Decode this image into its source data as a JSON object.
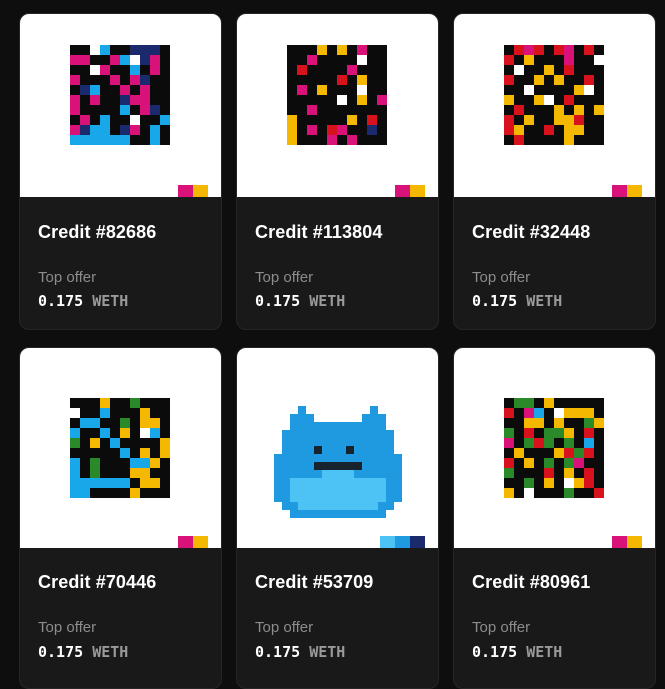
{
  "cards": [
    {
      "title": "Credit #82686",
      "offer_label": "Top offer",
      "price": "0.175",
      "currency": "WETH",
      "art": {
        "cols": 10,
        "rows": 10,
        "palette": [
          "#0b0b0b",
          "#d9127a",
          "#18a7e8",
          "#ffffff",
          "#1a2a6c"
        ],
        "pixels": [
          "0032004440",
          "1100123410",
          "0031002010",
          "1000101400",
          "0420010100",
          "1010041100",
          "1000020140",
          "0102003002",
          "1422041020",
          "2222220020"
        ]
      },
      "swatch": [
        "#d9127a",
        "#f5b800"
      ]
    },
    {
      "title": "Credit #113804",
      "offer_label": "Top offer",
      "price": "0.175",
      "currency": "WETH",
      "art": {
        "cols": 10,
        "rows": 10,
        "palette": [
          "#0b0b0b",
          "#d9127a",
          "#f5b800",
          "#18a7e8",
          "#ffffff",
          "#d8121c",
          "#1a2a6c"
        ],
        "pixels": [
          "0002020100",
          "0010000400",
          "0500001000",
          "0000050200",
          "0102000400",
          "0000040201",
          "0010000000",
          "2000002050",
          "2010510060",
          "2000101000"
        ]
      },
      "swatch": [
        "#d9127a",
        "#f5b800"
      ]
    },
    {
      "title": "Credit #32448",
      "offer_label": "Top offer",
      "price": "0.175",
      "currency": "WETH",
      "art": {
        "cols": 10,
        "rows": 10,
        "palette": [
          "#0b0b0b",
          "#d8121c",
          "#f5b800",
          "#ffffff",
          "#d9127a"
        ],
        "pixels": [
          "0141014010",
          "1020004003",
          "0300201000",
          "1002020010",
          "0030000230",
          "2002301000",
          "0100020202",
          "1020022100",
          "1200102200",
          "0100002000"
        ]
      },
      "swatch": [
        "#d9127a",
        "#f5b800"
      ]
    },
    {
      "title": "Credit #70446",
      "offer_label": "Top offer",
      "price": "0.175",
      "currency": "WETH",
      "art": {
        "cols": 10,
        "rows": 10,
        "palette": [
          "#0b0b0b",
          "#f5b800",
          "#18a7e8",
          "#2a8a2a",
          "#ffffff"
        ],
        "pixels": [
          "0001003000",
          "4002000100",
          "0220030110",
          "2002010420",
          "3010200001",
          "0000020101",
          "2030002210",
          "2030001100",
          "2222220110",
          "2200001000"
        ]
      },
      "swatch": [
        "#d9127a",
        "#f5b800"
      ]
    },
    {
      "title": "Credit #53709",
      "offer_label": "Top offer",
      "price": "0.175",
      "currency": "WETH",
      "art": {
        "cols": 16,
        "rows": 15,
        "palette": [
          "transparent",
          "#1f9ae0",
          "#17232f",
          "#4cc3f4"
        ],
        "pixels": [
          "0000000000000000",
          "0001000000001000",
          "0011100000011100",
          "0011111111111100",
          "0111111111111110",
          "0111111111111110",
          "0111121112111110",
          "1111111111111111",
          "1111122222211111",
          "1111113333111111",
          "1133333333333311",
          "1133333333333311",
          "1133333333333311",
          "0113333333333110",
          "0011111111111100"
        ]
      },
      "swatch": [
        "#4cc3f4",
        "#1f9ae0",
        "#1a2a6c"
      ]
    },
    {
      "title": "Credit #80961",
      "offer_label": "Top offer",
      "price": "0.175",
      "currency": "WETH",
      "art": {
        "cols": 10,
        "rows": 10,
        "palette": [
          "#0b0b0b",
          "#d8121c",
          "#f5b800",
          "#2a8a2a",
          "#18a7e8",
          "#ffffff",
          "#d9127a"
        ],
        "pixels": [
          "0330200000",
          "1064052220",
          "0022020032",
          "3010332010",
          "6031303040",
          "0200021310",
          "1020303600",
          "3000102010",
          "0030205210",
          "2050003001"
        ]
      },
      "swatch": [
        "#d9127a",
        "#f5b800"
      ]
    }
  ]
}
